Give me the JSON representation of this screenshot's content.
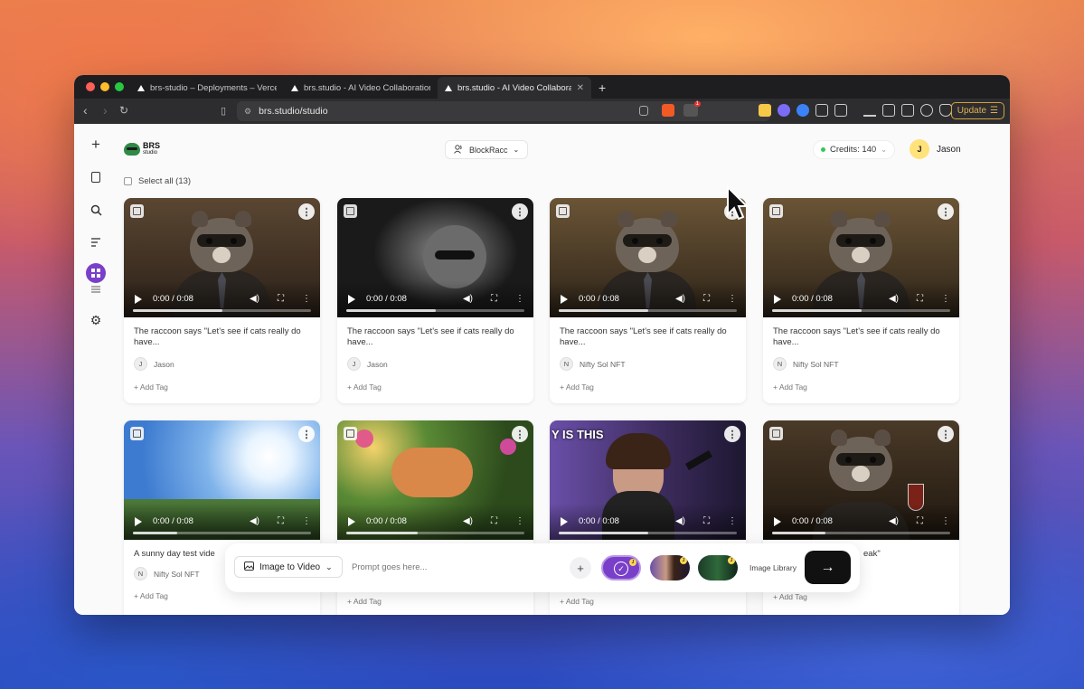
{
  "browser": {
    "tabs": [
      {
        "label": "brs-studio – Deployments – Vercel",
        "active": false
      },
      {
        "label": "brs.studio - AI Video Collaboration",
        "active": false
      },
      {
        "label": "brs.studio - AI Video Collabora",
        "active": true
      }
    ],
    "url": "brs.studio/studio",
    "update_label": "Update",
    "notification_count": "1"
  },
  "app": {
    "logo_line1": "BRS",
    "logo_line2": "studio",
    "workspace_label": "BlockRacc",
    "credits_label": "Credits: 140",
    "user_initial": "J",
    "user_name": "Jason",
    "select_all_label": "Select all (13)"
  },
  "cards": [
    {
      "title": "The raccoon says \"Let's see if cats really do have...",
      "owner_initial": "J",
      "owner": "Jason",
      "time": "0:00 / 0:08",
      "tag": "+ Add Tag",
      "progress": 0.5
    },
    {
      "title": "The raccoon says \"Let's see if cats really do have...",
      "owner_initial": "J",
      "owner": "Jason",
      "time": "0:00 / 0:08",
      "tag": "+ Add Tag",
      "progress": 0.5
    },
    {
      "title": "The raccoon says \"Let's see if cats really do have...",
      "owner_initial": "N",
      "owner": "Nifty Sol NFT",
      "time": "0:00 / 0:08",
      "tag": "+ Add Tag",
      "progress": 0.5
    },
    {
      "title": "The raccoon says \"Let's see if cats really do have...",
      "owner_initial": "N",
      "owner": "Nifty Sol NFT",
      "time": "0:00 / 0:08",
      "tag": "+ Add Tag",
      "progress": 0.5
    },
    {
      "title": "A sunny day test vide",
      "owner_initial": "N",
      "owner": "Nifty Sol NFT",
      "time": "0:00 / 0:08",
      "tag": "+ Add Tag",
      "progress": 0.25
    },
    {
      "title": "",
      "owner_initial": "",
      "owner": "",
      "time": "0:00 / 0:08",
      "tag": "+ Add Tag",
      "progress": 0.4
    },
    {
      "title": "",
      "owner_initial": "",
      "owner": "",
      "time": "0:00 / 0:08",
      "tag": "+ Add Tag",
      "progress": 0.5,
      "overlay_text": "Y IS THIS"
    },
    {
      "title": "eak\"",
      "owner_initial": "",
      "owner": "",
      "time": "0:00 / 0:08",
      "tag": "+ Add Tag",
      "progress": 0.3
    }
  ],
  "prompt_bar": {
    "mode_label": "Image to Video",
    "placeholder": "Prompt goes here...",
    "image_library_label": "Image Library"
  },
  "icons": {
    "rail": [
      "plus-icon",
      "book-icon",
      "search-icon",
      "sort-icon",
      "grid-icon",
      "list-icon",
      "gear-icon"
    ]
  },
  "colors": {
    "accent_purple": "#7a3fc9",
    "credits_dot": "#34c759",
    "avatar_yellow": "#ffe27a"
  }
}
